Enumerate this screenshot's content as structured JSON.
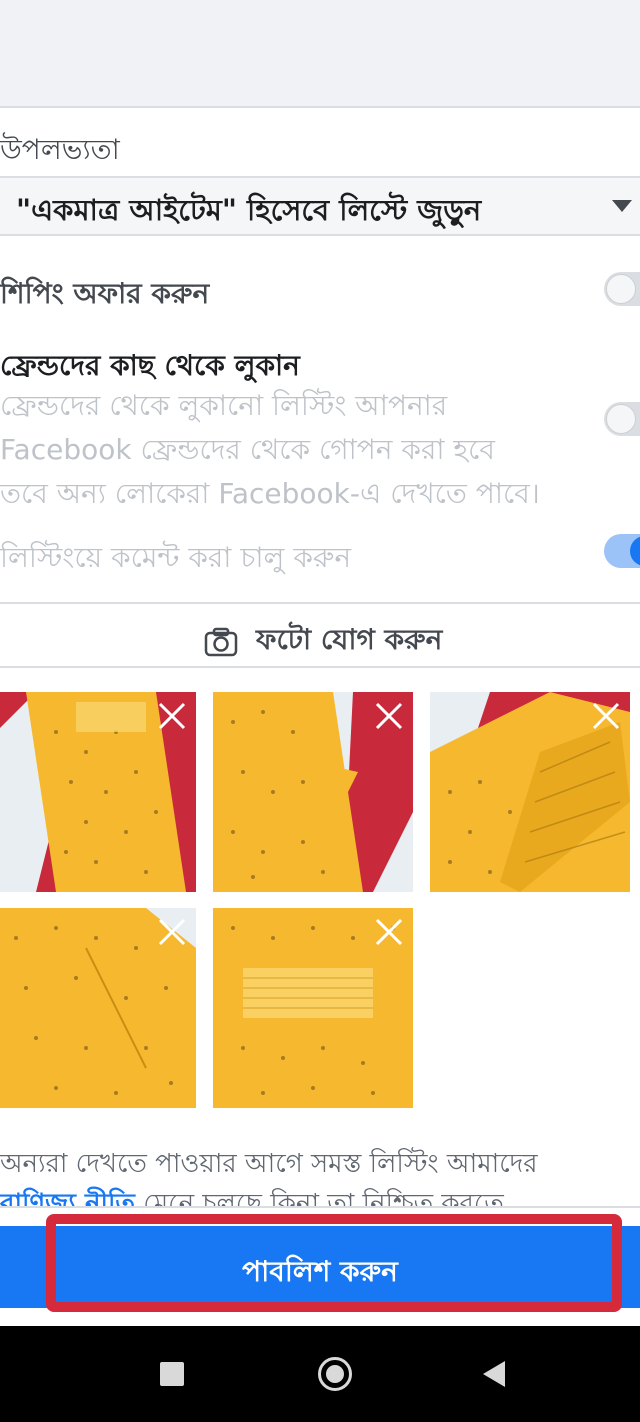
{
  "availability": {
    "label": "উপলভ্যতা",
    "selected": "\"একমাত্র আইটেম\" হিসেবে লিস্টে জুড়ুন"
  },
  "shipping": {
    "label": "শিপিং অফার করুন",
    "enabled": false
  },
  "hide_from_friends": {
    "title": "ফ্রেন্ডদের কাছ থেকে লুকান",
    "description_lines": [
      "ফ্রেন্ডদের থেকে লুকানো লিস্টিং আপনার",
      "Facebook ফ্রেন্ডদের থেকে গোপন করা হবে",
      "তবে অন্য লোকেরা Facebook-এ দেখতে পাবে।"
    ],
    "enabled": false
  },
  "comments": {
    "label": "লিস্টিংয়ে কমেন্ট করা চালু করুন",
    "enabled": true
  },
  "add_photo": {
    "label": "ফটো যোগ করুন",
    "icon": "camera-icon"
  },
  "photos": [
    {
      "name": "photo-1",
      "remove_icon": "close-icon"
    },
    {
      "name": "photo-2",
      "remove_icon": "close-icon"
    },
    {
      "name": "photo-3",
      "remove_icon": "close-icon"
    },
    {
      "name": "photo-4",
      "remove_icon": "close-icon"
    },
    {
      "name": "photo-5",
      "remove_icon": "close-icon"
    }
  ],
  "notice": {
    "line1": "অন্যরা দেখতে পাওয়ার আগে সমস্ত লিস্টিং আমাদের",
    "link": "বাণিজ্য নীতি",
    "line2_rest": " মেনে চলছে কিনা তা নিশ্চিত করতে"
  },
  "publish": {
    "label": "পাবলিশ করুন"
  },
  "colors": {
    "accent": "#1877f2",
    "highlight": "#d42a3c",
    "garment": "#f5b82e"
  },
  "system_nav": {
    "recents_icon": "square-icon",
    "home_icon": "home-circle-icon",
    "back_icon": "back-triangle-icon"
  }
}
